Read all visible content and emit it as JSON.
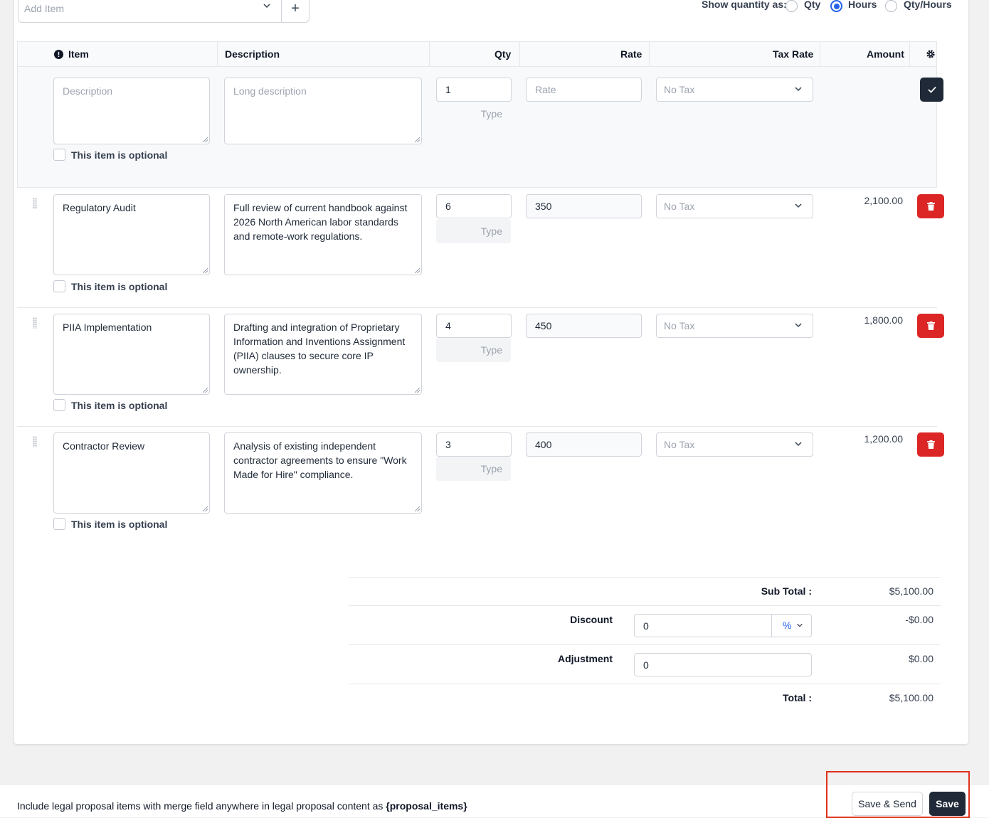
{
  "add_item": {
    "placeholder": "Add Item",
    "plus_icon": "+"
  },
  "show_quantity": {
    "label": "Show quantity as:",
    "options": [
      {
        "label": "Qty",
        "selected": false
      },
      {
        "label": "Hours",
        "selected": true
      },
      {
        "label": "Qty/Hours",
        "selected": false
      }
    ]
  },
  "table": {
    "headers": {
      "item": "Item",
      "description": "Description",
      "qty": "Qty",
      "rate": "Rate",
      "tax_rate": "Tax Rate",
      "amount": "Amount"
    },
    "new_item": {
      "item_placeholder": "Description",
      "description_placeholder": "Long description",
      "qty": "1",
      "unit_placeholder": "Type",
      "rate_placeholder": "Rate",
      "tax": "No Tax",
      "optional_label": "This item is optional"
    },
    "rows": [
      {
        "item": "Regulatory Audit",
        "description": "Full review of current handbook against 2026 North American labor standards and remote-work regulations.",
        "qty": "6",
        "unit": "Type",
        "rate": "350",
        "tax": "No Tax",
        "amount": "2,100.00",
        "optional_label": "This item is optional"
      },
      {
        "item": "PIIA Implementation",
        "description": "Drafting and integration of Proprietary Information and Inventions Assignment (PIIA) clauses to secure core IP ownership.",
        "qty": "4",
        "unit": "Type",
        "rate": "450",
        "tax": "No Tax",
        "amount": "1,800.00",
        "optional_label": "This item is optional"
      },
      {
        "item": "Contractor Review",
        "description": "Analysis of existing independent contractor agreements to ensure \"Work Made for Hire\" compliance.",
        "qty": "3",
        "unit": "Type",
        "rate": "400",
        "tax": "No Tax",
        "amount": "1,200.00",
        "optional_label": "This item is optional"
      }
    ]
  },
  "totals": {
    "subtotal_label": "Sub Total :",
    "subtotal": "$5,100.00",
    "discount_label": "Discount",
    "discount_input": "0",
    "discount_type": "%",
    "discount_value": "-$0.00",
    "adjustment_label": "Adjustment",
    "adjustment_input": "0",
    "adjustment_value": "$0.00",
    "total_label": "Total :",
    "total": "$5,100.00"
  },
  "footer": {
    "note": "Include legal proposal items with merge field anywhere in legal proposal content as ",
    "merge_field": "{proposal_items}",
    "save_send_label": "Save & Send",
    "save_label": "Save"
  },
  "colors": {
    "accent": "#2563eb",
    "danger": "#dc2626",
    "dark_button": "#1f2937",
    "highlight_box": "#e0321c"
  }
}
